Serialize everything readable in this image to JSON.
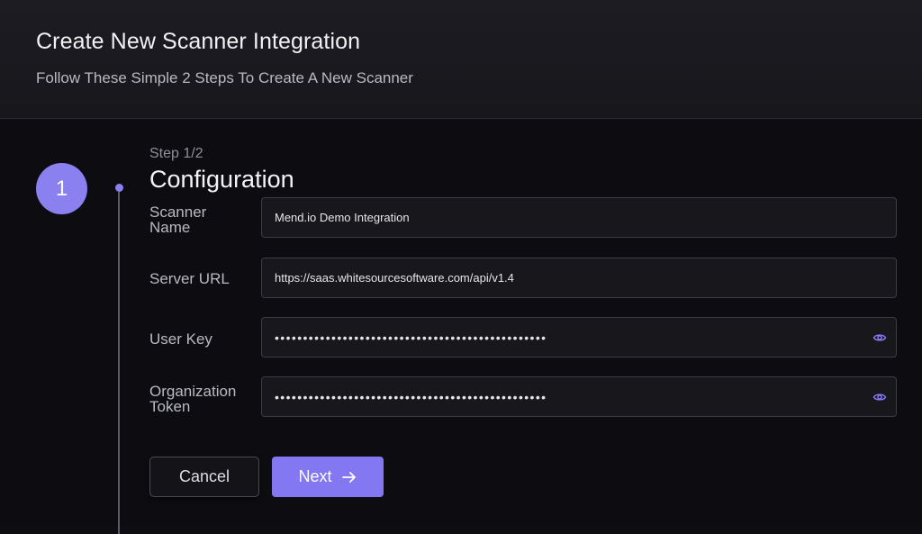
{
  "header": {
    "title": "Create New Scanner Integration",
    "subtitle": "Follow These Simple 2 Steps To Create A New Scanner"
  },
  "step": {
    "number": "1",
    "label": "Step 1/2",
    "heading": "Configuration"
  },
  "form": {
    "scanner_name": {
      "label_line1": "Scanner",
      "label_line2": "Name",
      "value": "Mend.io Demo Integration"
    },
    "server_url": {
      "label": "Server URL",
      "value": "https://saas.whitesourcesoftware.com/api/v1.4"
    },
    "user_key": {
      "label": "User Key",
      "value": "••••••••••••••••••••••••••••••••••••••••••••••••",
      "icon": "eye-icon"
    },
    "org_token": {
      "label_line1": "Organization",
      "label_line2": "Token",
      "value": "••••••••••••••••••••••••••••••••••••••••••••••••",
      "icon": "eye-icon"
    }
  },
  "actions": {
    "cancel_label": "Cancel",
    "next_label": "Next",
    "next_icon": "arrow-right-icon"
  },
  "colors": {
    "accent": "#8477f2",
    "step_circle": "#8a80f0",
    "background": "#0d0d11",
    "header_bg": "#1c1c22"
  }
}
